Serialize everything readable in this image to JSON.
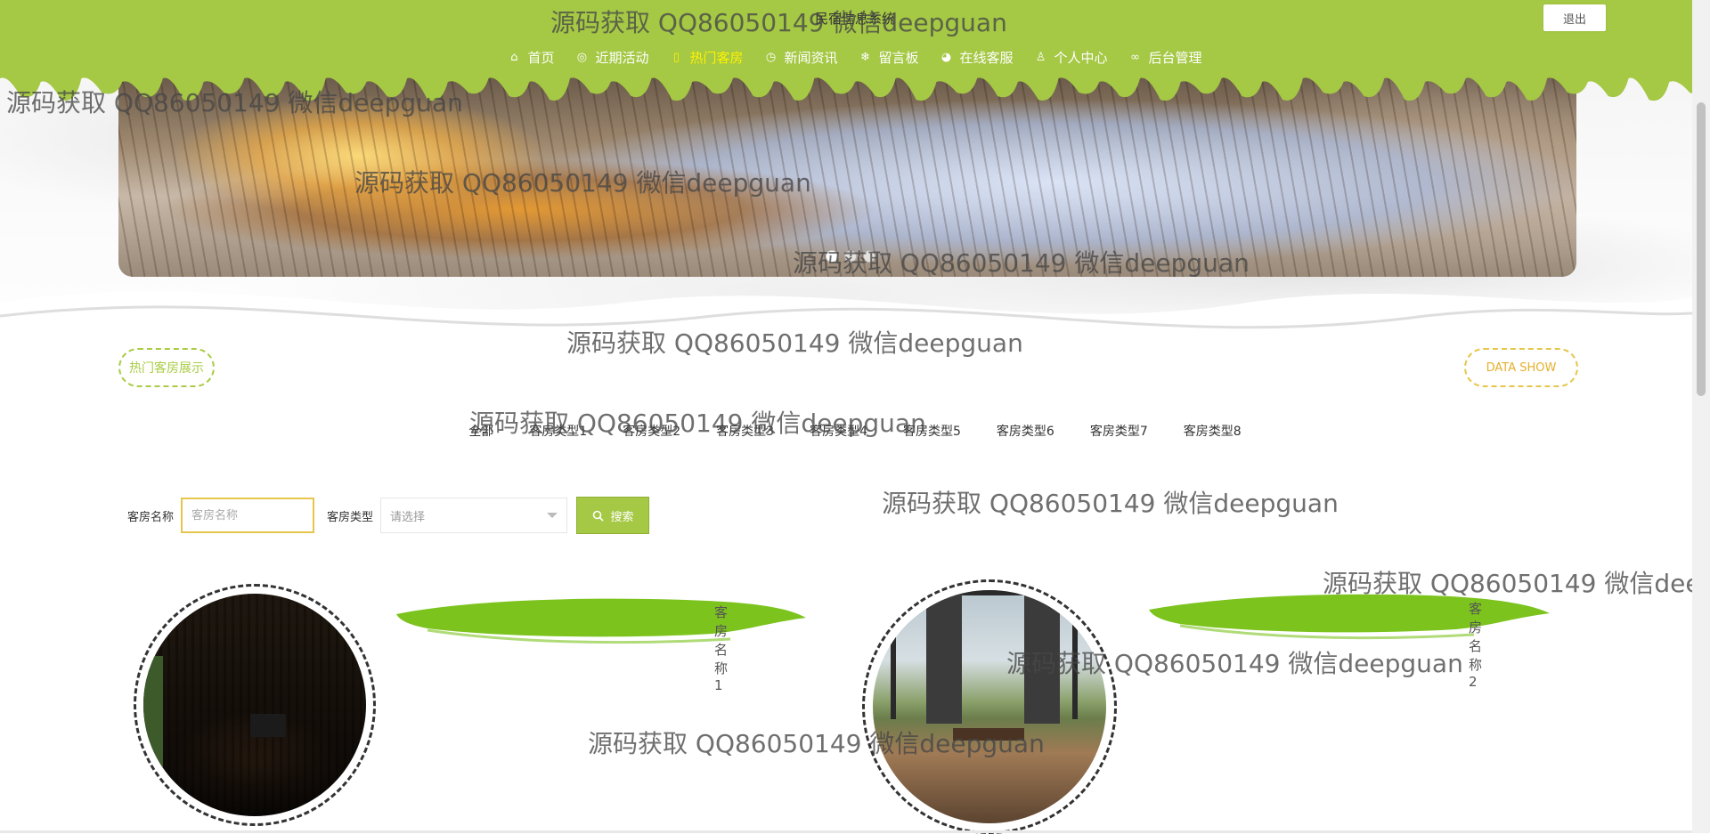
{
  "header": {
    "site_title": "民宿信息系统",
    "logout_label": "退出",
    "nav": [
      {
        "label": "首页",
        "icon": "home-icon",
        "glyph": "⌂",
        "active": false
      },
      {
        "label": "近期活动",
        "icon": "activity-icon",
        "glyph": "◎",
        "active": false
      },
      {
        "label": "热门客房",
        "icon": "room-icon",
        "glyph": "▯",
        "active": true
      },
      {
        "label": "新闻资讯",
        "icon": "clock-icon",
        "glyph": "◷",
        "active": false
      },
      {
        "label": "留言板",
        "icon": "snowflake-icon",
        "glyph": "❄",
        "active": false
      },
      {
        "label": "在线客服",
        "icon": "service-icon",
        "glyph": "◕",
        "active": false
      },
      {
        "label": "个人中心",
        "icon": "user-icon",
        "glyph": "♙",
        "active": false
      },
      {
        "label": "后台管理",
        "icon": "link-icon",
        "glyph": "∞",
        "active": false
      }
    ]
  },
  "banner": {
    "slides": 3,
    "active_slide": 1
  },
  "section": {
    "title": "热门客房展示",
    "subtitle": "DATA SHOW"
  },
  "tabs": [
    "全部",
    "客房类型1",
    "客房类型2",
    "客房类型3",
    "客房类型4",
    "客房类型5",
    "客房类型6",
    "客房类型7",
    "客房类型8"
  ],
  "search": {
    "name_label": "客房名称",
    "name_placeholder": "客房名称",
    "type_label": "客房类型",
    "type_placeholder": "请选择",
    "button_label": "搜索"
  },
  "rooms": [
    {
      "name": "客房名称1"
    },
    {
      "name": "客房名称2"
    }
  ],
  "watermark": "源码获取 QQ86050149 微信deepguan",
  "colors": {
    "header_green": "#a5c845",
    "active_nav": "#fff200",
    "pill_green": "#a9cc45",
    "pill_gold": "#e6b02c",
    "brush_green": "#7cc31e"
  }
}
